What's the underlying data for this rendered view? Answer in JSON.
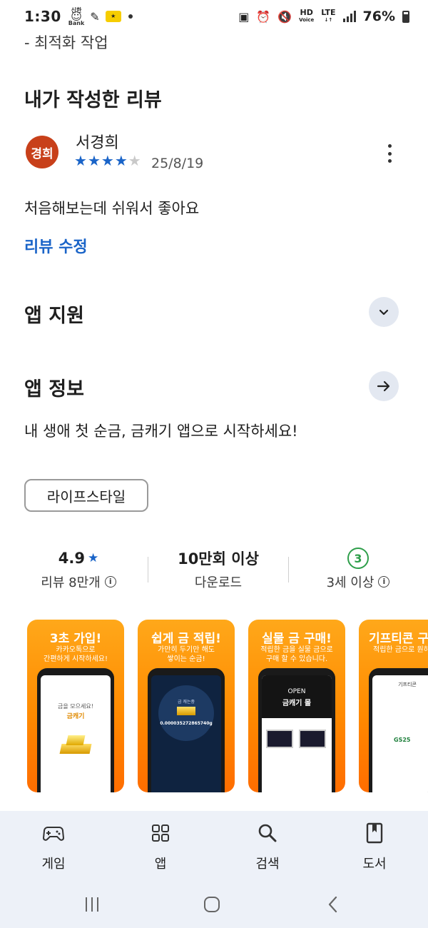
{
  "status_bar": {
    "time": "1:30",
    "bank_top": "신한",
    "bank_bottom": "Bank",
    "network_hd": "HD",
    "network_voice": "Voice",
    "network_lte": "LTE",
    "battery": "76%"
  },
  "top_note": "- 최적화 작업",
  "my_review": {
    "title": "내가 작성한 리뷰",
    "avatar_text": "경희",
    "avatar_color": "#c8401a",
    "reviewer": "서경희",
    "rating": 4,
    "max_rating": 5,
    "date": "25/8/19",
    "text": "처음해보는데 쉬워서 좋아요",
    "edit_label": "리뷰 수정"
  },
  "app_support": {
    "title": "앱 지원",
    "icon": "chevron-down-icon"
  },
  "app_info": {
    "title": "앱 정보",
    "icon": "arrow-right-icon",
    "description": "내 생애 첫 순금, 금캐기 앱으로 시작하세요!"
  },
  "category_chip": "라이프스타일",
  "stats": {
    "rating_value": "4.9",
    "rating_label": "리뷰 8만개",
    "downloads_value": "10만회 이상",
    "downloads_label": "다운로드",
    "age_value": "3",
    "age_label": "3세 이상"
  },
  "screenshots": [
    {
      "title": "3초 가입!",
      "subtitle": "카카오톡으로\n간편하게 시작하세요!",
      "screen_line1": "금을 모으세요!",
      "screen_line2": "금캐기"
    },
    {
      "title": "쉽게 금 적립!",
      "subtitle": "가만히 두기만 해도\n쌓이는 순금!",
      "screen_line1": "0.000035272865740g",
      "screen_line2": "금 캐는중"
    },
    {
      "title": "실물 금 구매!",
      "subtitle": "적립한 금을 실물 금으로\n구매 할 수 있습니다.",
      "screen_line1": "OPEN",
      "screen_line2": "금캐기 몰"
    },
    {
      "title": "기프티콘 구",
      "subtitle": "적립한 금으로 원하\n기프티콘을 구매하",
      "screen_line1": "기프티콘",
      "screen_line2": "GS25"
    }
  ],
  "bottom_nav": [
    {
      "label": "게임",
      "icon": "gamepad-icon"
    },
    {
      "label": "앱",
      "icon": "apps-grid-icon"
    },
    {
      "label": "검색",
      "icon": "search-icon"
    },
    {
      "label": "도서",
      "icon": "book-icon"
    }
  ],
  "colors": {
    "accent": "#1a64c8",
    "age_badge": "#2e9e4a",
    "nav_bg": "#edf1f8",
    "promo_orange": "#ff8a00"
  }
}
